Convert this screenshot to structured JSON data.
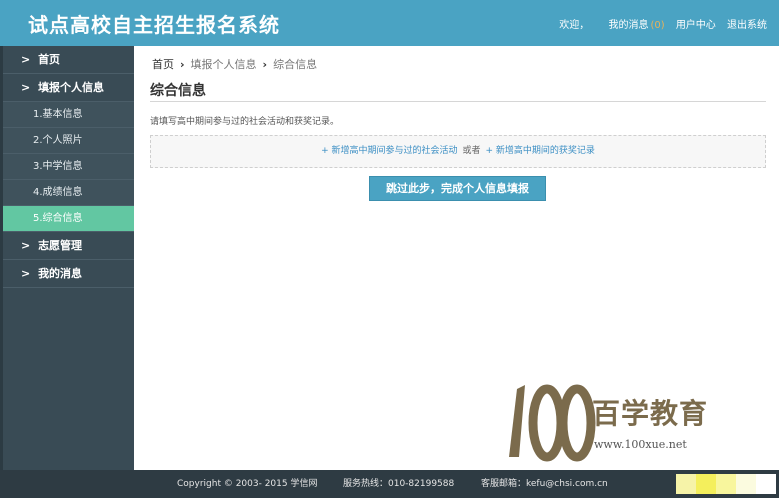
{
  "header": {
    "title": "试点高校自主招生报名系统",
    "welcome": "欢迎，",
    "messages_label": "我的消息",
    "messages_count": "(0)",
    "user_center": "用户中心",
    "logout": "退出系统"
  },
  "sidebar": {
    "items": [
      {
        "label": "首页"
      },
      {
        "label": "填报个人信息"
      }
    ],
    "sub_items": [
      {
        "label": "1.基本信息"
      },
      {
        "label": "2.个人照片"
      },
      {
        "label": "3.中学信息"
      },
      {
        "label": "4.成绩信息"
      },
      {
        "label": "5.综合信息"
      }
    ],
    "items_after": [
      {
        "label": "志愿管理"
      },
      {
        "label": "我的消息"
      }
    ]
  },
  "breadcrumb": {
    "home": "首页",
    "level1": "填报个人信息",
    "level2": "综合信息"
  },
  "main": {
    "title": "综合信息",
    "hint": "请填写高中期间参与过的社会活动和获奖记录。",
    "add_activity": "+ 新增高中期间参与过的社会活动",
    "or": "或者",
    "add_award": "+ 新增高中期间的获奖记录",
    "skip_button": "跳过此步，完成个人信息填报"
  },
  "watermark": {
    "number": "100",
    "cn": "百学教育",
    "url": "www.100xue.net"
  },
  "footer": {
    "copyright": "Copyright © 2003- 2015 学信网",
    "phone": "服务热线：010-82199588",
    "email": "客服邮箱：kefu@chsi.com.cn"
  },
  "colors": {
    "header_bg": "#4aa3c3",
    "sidebar_bg": "#394b55",
    "active_item": "#62c7a2",
    "footer_bg": "#2e3b43",
    "link": "#3c8fc4"
  }
}
